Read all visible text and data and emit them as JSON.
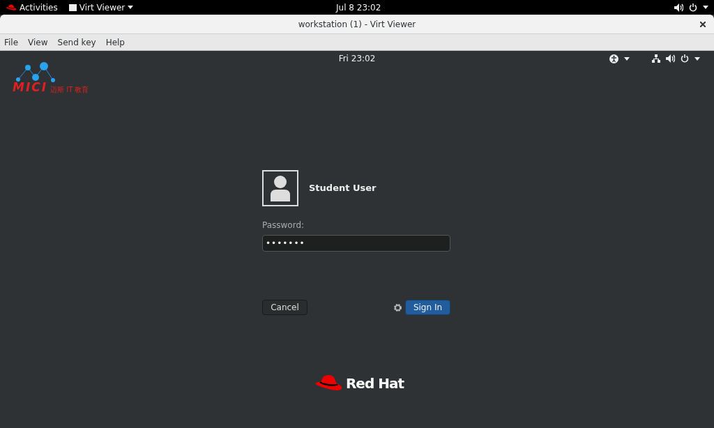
{
  "host_bar": {
    "activities": "Activities",
    "app_menu": "Virt Viewer",
    "clock": "Jul 8  23:02"
  },
  "window": {
    "title": "workstation (1) - Virt Viewer"
  },
  "menu": [
    "File",
    "View",
    "Send key",
    "Help"
  ],
  "guest_bar": {
    "clock": "Fri 23:02"
  },
  "logo": {
    "wordmark": "MICI",
    "subtitle": "迈斯 IT 教育"
  },
  "login": {
    "user": "Student User",
    "password_label": "Password:",
    "password_value": "•••••••",
    "cancel": "Cancel",
    "sign_in": "Sign In"
  },
  "footer": {
    "brand": "Red Hat"
  }
}
